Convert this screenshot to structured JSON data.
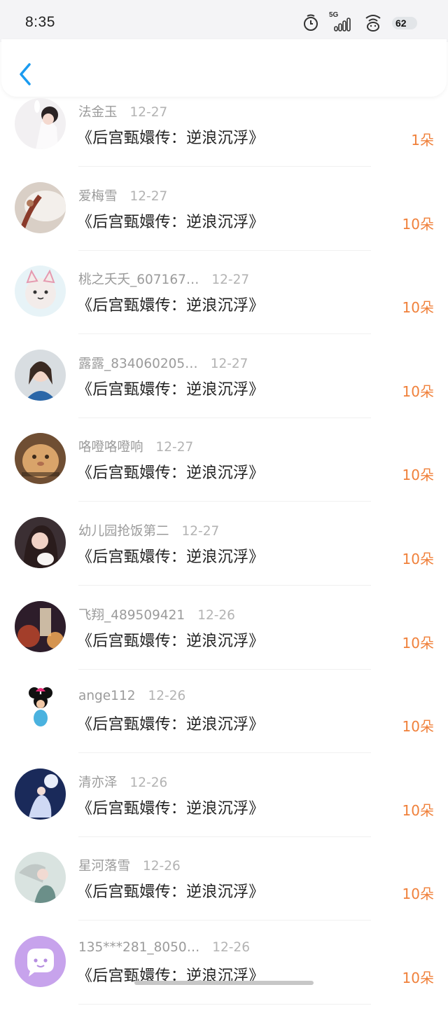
{
  "status": {
    "time": "8:35",
    "network": "5G",
    "battery": "62"
  },
  "nav": {
    "back_icon": "chevron-left-icon"
  },
  "colors": {
    "accent": "#1a9bf0",
    "amount": "#f0803a",
    "meta": "#9b9b9b",
    "title": "#222222"
  },
  "rows": [
    {
      "name": "法金玉",
      "date": "12-27",
      "title": "《后宫甄嬛传：逆浪沉浮》",
      "amount": "1朵"
    },
    {
      "name": "爱梅雪",
      "date": "12-27",
      "title": "《后宫甄嬛传：逆浪沉浮》",
      "amount": "10朵"
    },
    {
      "name": "桃之夭夭_607167…",
      "date": "12-27",
      "title": "《后宫甄嬛传：逆浪沉浮》",
      "amount": "10朵"
    },
    {
      "name": "露露_834060205…",
      "date": "12-27",
      "title": "《后宫甄嬛传：逆浪沉浮》",
      "amount": "10朵"
    },
    {
      "name": "咯噔咯噔响",
      "date": "12-27",
      "title": "《后宫甄嬛传：逆浪沉浮》",
      "amount": "10朵"
    },
    {
      "name": "幼儿园抢饭第二",
      "date": "12-27",
      "title": "《后宫甄嬛传：逆浪沉浮》",
      "amount": "10朵"
    },
    {
      "name": "飞翔_489509421",
      "date": "12-26",
      "title": "《后宫甄嬛传：逆浪沉浮》",
      "amount": "10朵"
    },
    {
      "name": "ange112",
      "date": "12-26",
      "title": "《后宫甄嬛传：逆浪沉浮》",
      "amount": "10朵"
    },
    {
      "name": "清亦泽",
      "date": "12-26",
      "title": "《后宫甄嬛传：逆浪沉浮》",
      "amount": "10朵"
    },
    {
      "name": "星河落雪",
      "date": "12-26",
      "title": "《后宫甄嬛传：逆浪沉浮》",
      "amount": "10朵"
    },
    {
      "name": "135***281_8050…",
      "date": "12-26",
      "title": "《后宫甄嬛传：逆浪沉浮》",
      "amount": "10朵"
    }
  ]
}
